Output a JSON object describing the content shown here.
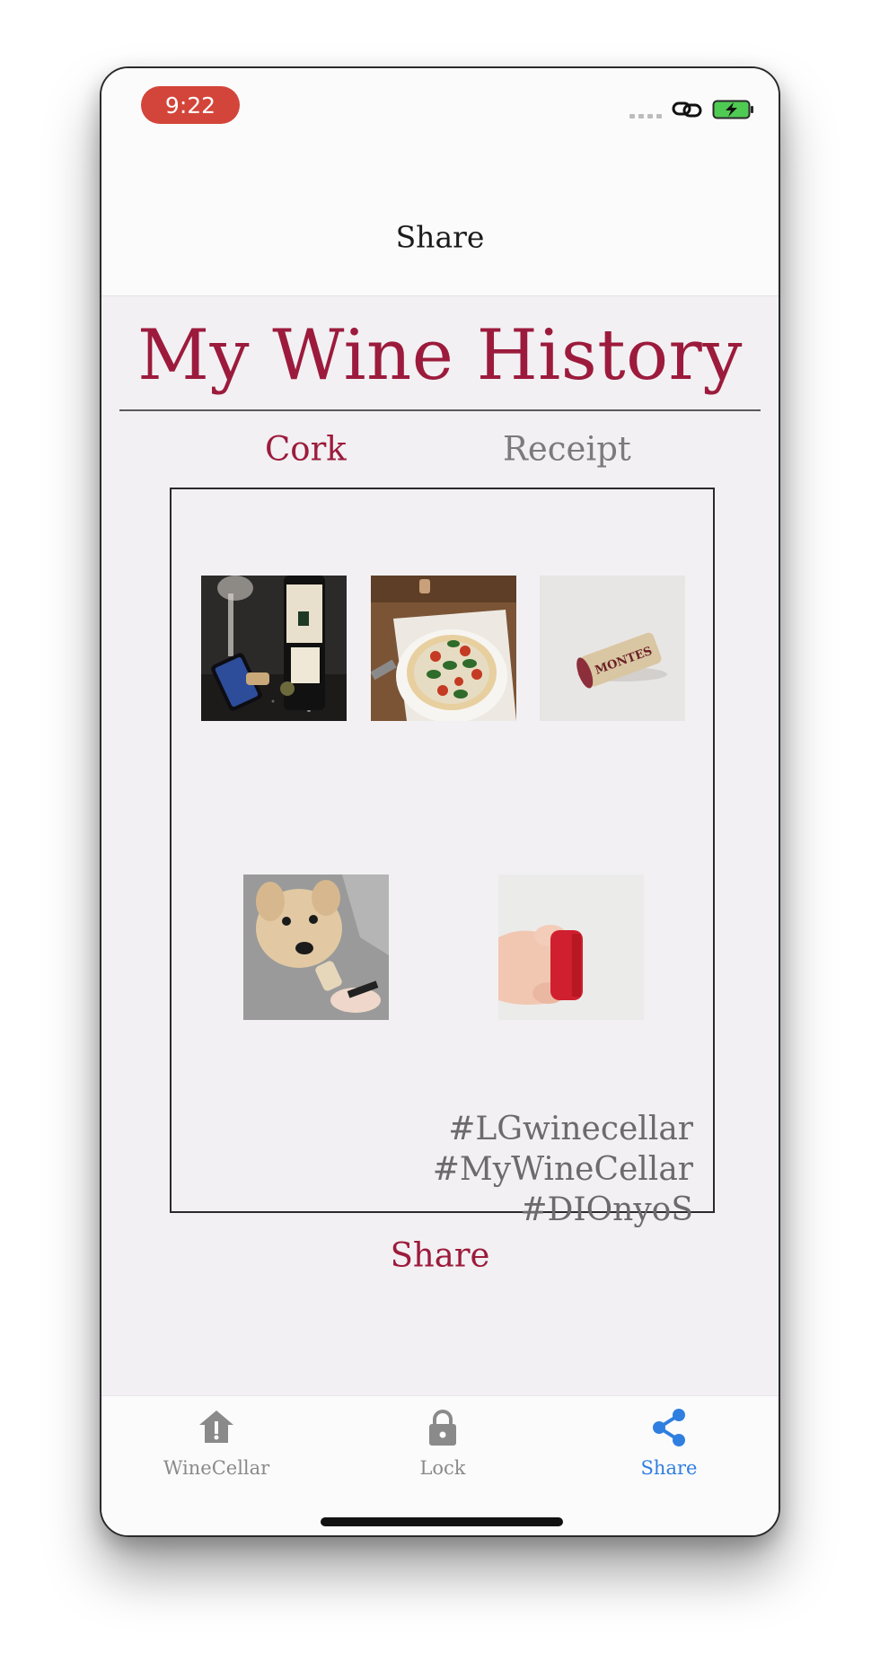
{
  "status_bar": {
    "time": "9:22",
    "time_pill_color": "#d3453a"
  },
  "nav": {
    "title": "Share"
  },
  "page": {
    "title": "My Wine History",
    "accent_color": "#9c1b3c"
  },
  "segments": [
    {
      "label": "Cork",
      "selected": true
    },
    {
      "label": "Receipt",
      "selected": false
    }
  ],
  "photos": [
    {
      "icon": "wine-bottle-photo"
    },
    {
      "icon": "pizza-photo"
    },
    {
      "icon": "cork-montes-photo"
    },
    {
      "icon": "dog-with-cork-photo"
    },
    {
      "icon": "red-cork-in-hand-photo"
    }
  ],
  "hashtags": {
    "line1": "#LGwinecellar #MyWineCellar",
    "line2": "#DIOnyoS"
  },
  "share_button": {
    "label": "Share"
  },
  "tab_bar": {
    "items": [
      {
        "label": "WineCellar",
        "icon": "cellar-icon",
        "active": false
      },
      {
        "label": "Lock",
        "icon": "lock-icon",
        "active": false
      },
      {
        "label": "Share",
        "icon": "share-icon",
        "active": true
      }
    ],
    "active_color": "#2f7fe0"
  }
}
